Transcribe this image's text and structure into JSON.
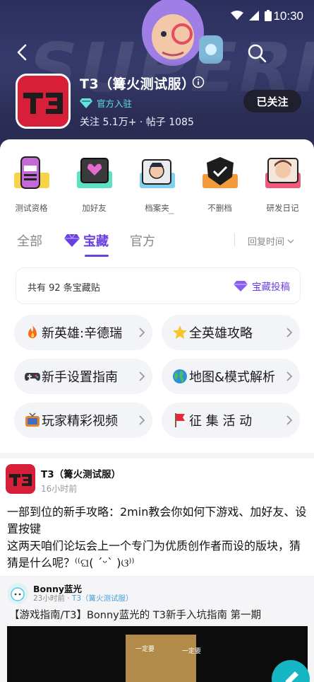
{
  "status_bar": {
    "time": "10:30"
  },
  "header": {
    "banner_text": "SUPERI",
    "game_name": "T3（篝火测试服）",
    "official_badge": "官方入驻",
    "stats": "关注 5.1万+ · 帖子 1085",
    "follow_label": "已关注",
    "logo_text": "T3"
  },
  "shortcuts": [
    {
      "label": "测试资格",
      "icon": "test-qualification-icon"
    },
    {
      "label": "加好友",
      "icon": "add-friend-icon"
    },
    {
      "label": "档案夹",
      "icon": "archive-folder-icon"
    },
    {
      "label": "不删档",
      "icon": "no-wipe-icon"
    },
    {
      "label": "研发日记",
      "icon": "dev-diary-icon"
    }
  ],
  "tabs": [
    {
      "label": "全部",
      "active": false
    },
    {
      "label": "宝藏",
      "active": true
    },
    {
      "label": "官方",
      "active": false
    }
  ],
  "sort_label": "回复时间",
  "treasure": {
    "count_text": "共有 92 条宝藏贴",
    "submit_label": "宝藏投稿"
  },
  "chips": [
    {
      "label": "新英雄:辛德瑞",
      "icon": "fire-icon"
    },
    {
      "label": "全英雄攻略",
      "icon": "star-icon"
    },
    {
      "label": "新手设置指南",
      "icon": "gamepad-icon"
    },
    {
      "label": "地图&模式解析",
      "icon": "globe-icon"
    },
    {
      "label": "玩家精彩视频",
      "icon": "tv-icon"
    },
    {
      "label": "征 集 活 动",
      "icon": "flag-icon"
    }
  ],
  "post": {
    "author": "T3（篝火测试服）",
    "time": "16小时前",
    "body_line1": "一部到位的新手攻略：2min教会你如何下游戏、加好友、设置按键",
    "body_line2": "这两天咱们论坛会上一个专门为优质创作者而设的版块，猜猜是什么呢？⁽⁽ଘ( ˊᵕˋ )ଓ⁾⁾"
  },
  "quote": {
    "author": "Bonny蓝光",
    "time": "23小时前",
    "source": "T3（篝火测试服）",
    "title": "【游戏指南/T3】Bonny蓝光的 T3新手入坑指南 第一期",
    "video_caption_left": "一定要",
    "video_caption_right": "一定要"
  },
  "colors": {
    "accent": "#6c3fe0",
    "brand_red": "#d81f3a",
    "badge_cyan": "#60e3d8",
    "fab": "#15b6c4"
  }
}
